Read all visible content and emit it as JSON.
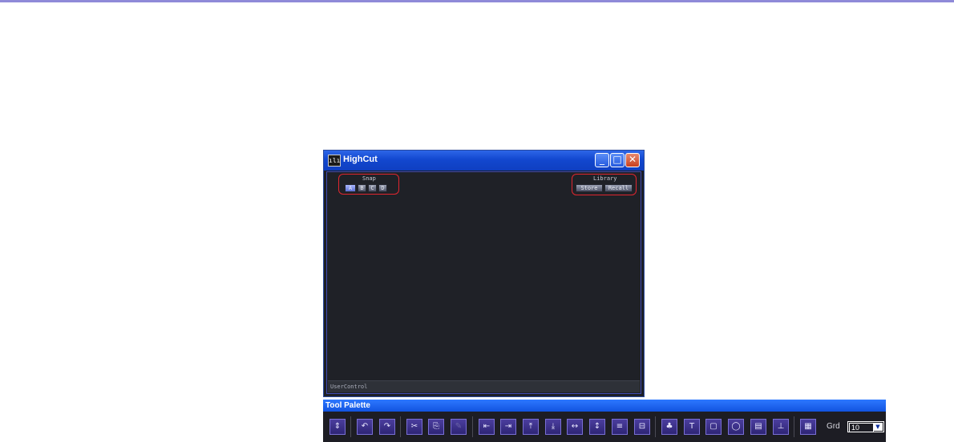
{
  "window": {
    "title": "HighCut",
    "icon": "waveform-app-icon",
    "controls": {
      "minimize": "_",
      "maximize": "□",
      "close": "✕"
    }
  },
  "snap": {
    "label": "Snap",
    "buttons": [
      "A",
      "B",
      "C",
      "D"
    ],
    "selected": "A"
  },
  "library": {
    "label": "Library",
    "store_label": "Store",
    "recall_label": "Recall"
  },
  "status": {
    "user_control": "UserControl"
  },
  "palette": {
    "title": "Tool Palette",
    "tools": [
      {
        "name": "select-tool-icon",
        "glyph": "⇕"
      },
      {
        "name": "undo-icon",
        "glyph": "↶"
      },
      {
        "name": "redo-icon",
        "glyph": "↷"
      },
      {
        "name": "cut-icon",
        "glyph": "✂"
      },
      {
        "name": "copy-icon",
        "glyph": "⎘"
      },
      {
        "name": "paste-icon",
        "glyph": "✎"
      },
      {
        "name": "align-left-icon",
        "glyph": "⇤"
      },
      {
        "name": "align-right-icon",
        "glyph": "⇥"
      },
      {
        "name": "align-top-icon",
        "glyph": "⤒"
      },
      {
        "name": "align-bottom-icon",
        "glyph": "⤓"
      },
      {
        "name": "distribute-horizontal-icon",
        "glyph": "↔"
      },
      {
        "name": "distribute-vertical-icon",
        "glyph": "↕"
      },
      {
        "name": "center-vertical-icon",
        "glyph": "≡"
      },
      {
        "name": "center-horizontal-icon",
        "glyph": "⊟"
      },
      {
        "name": "object-tool-icon",
        "glyph": "♣"
      },
      {
        "name": "text-tool-icon",
        "glyph": "T"
      },
      {
        "name": "box-tool-icon",
        "glyph": "▢"
      },
      {
        "name": "lasso-tool-icon",
        "glyph": "◯"
      },
      {
        "name": "frame-tool-icon",
        "glyph": "▤"
      },
      {
        "name": "line-tool-icon",
        "glyph": "⊥"
      },
      {
        "name": "grid-toggle-icon",
        "glyph": "▦"
      }
    ],
    "grid_label": "Grd",
    "grid_value": "10"
  }
}
